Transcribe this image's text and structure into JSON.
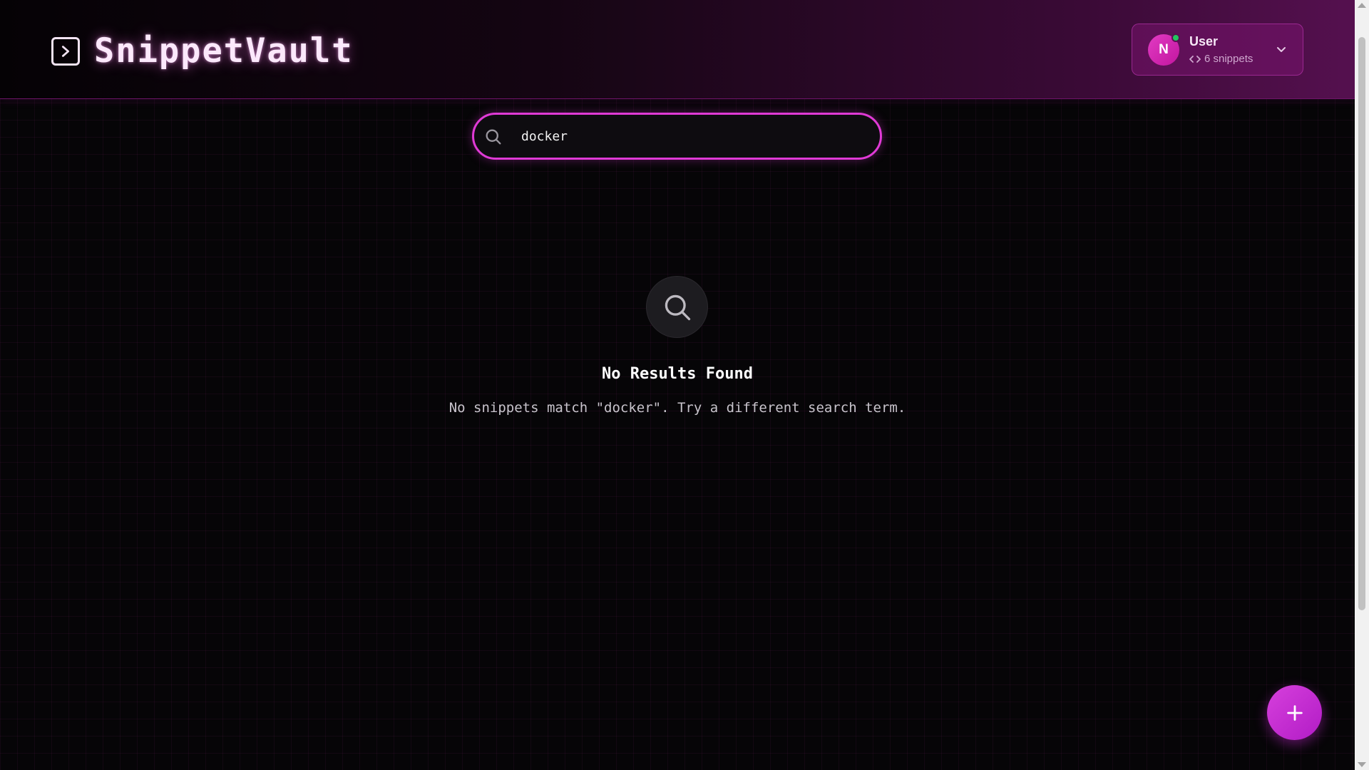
{
  "app": {
    "name": "SnippetVault",
    "logo_icon": "terminal-square-icon"
  },
  "user_menu": {
    "avatar_initial": "N",
    "name": "User",
    "snippet_count": "6 snippets",
    "online_status": "online",
    "icons": [
      "code-icon",
      "chevron-down-icon"
    ]
  },
  "search": {
    "value": "docker",
    "icon": "search-icon"
  },
  "empty_state": {
    "icon": "search-icon",
    "title": "No Results Found",
    "message": "No snippets match \"docker\". Try a different search term."
  },
  "fab": {
    "icon": "plus-icon"
  },
  "colors": {
    "accent": "#e03ad6",
    "fab": "#c62ed0",
    "avatar": "#d22ab4",
    "online": "#22c55e",
    "background": "#060507"
  }
}
